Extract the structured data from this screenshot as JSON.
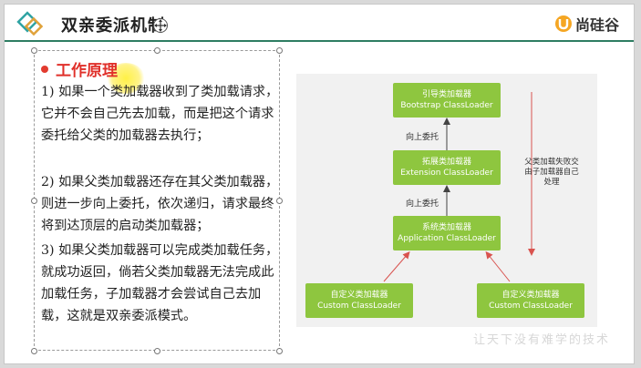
{
  "header": {
    "title": "双亲委派机制",
    "brand": "尚硅谷"
  },
  "content": {
    "heading": "工作原理",
    "paragraphs": [
      "1) 如果一个类加载器收到了类加载请求，它并不会自己先去加载，而是把这个请求委托给父类的加载器去执行；",
      "2) 如果父类加载器还存在其父类加载器，则进一步向上委托，依次递归，请求最终将到达顶层的启动类加载器；",
      "3) 如果父类加载器可以完成类加载任务，就成功返回，倘若父类加载器无法完成此加载任务，子加载器才会尝试自己去加载，这就是双亲委派模式。"
    ]
  },
  "diagram": {
    "bootstrap": {
      "cn": "引导类加载器",
      "en": "Bootstrap ClassLoader"
    },
    "extension": {
      "cn": "拓展类加载器",
      "en": "Extension ClassLoader"
    },
    "application": {
      "cn": "系统类加载器",
      "en": "Application ClassLoader"
    },
    "custom_left": {
      "cn": "自定义类加载器",
      "en": "Custom ClassLoader"
    },
    "custom_right": {
      "cn": "自定义类加载器",
      "en": "Custom ClassLoader"
    },
    "delegate_up_1": "向上委托",
    "delegate_up_2": "向上委托",
    "fallback_note": "父类加载失败交由子加载器自己处理"
  },
  "watermark": "让天下没有难学的技术",
  "colors": {
    "accent_line": "#2e7d62",
    "node_green": "#8ec63f",
    "heading_red": "#e0302a"
  }
}
